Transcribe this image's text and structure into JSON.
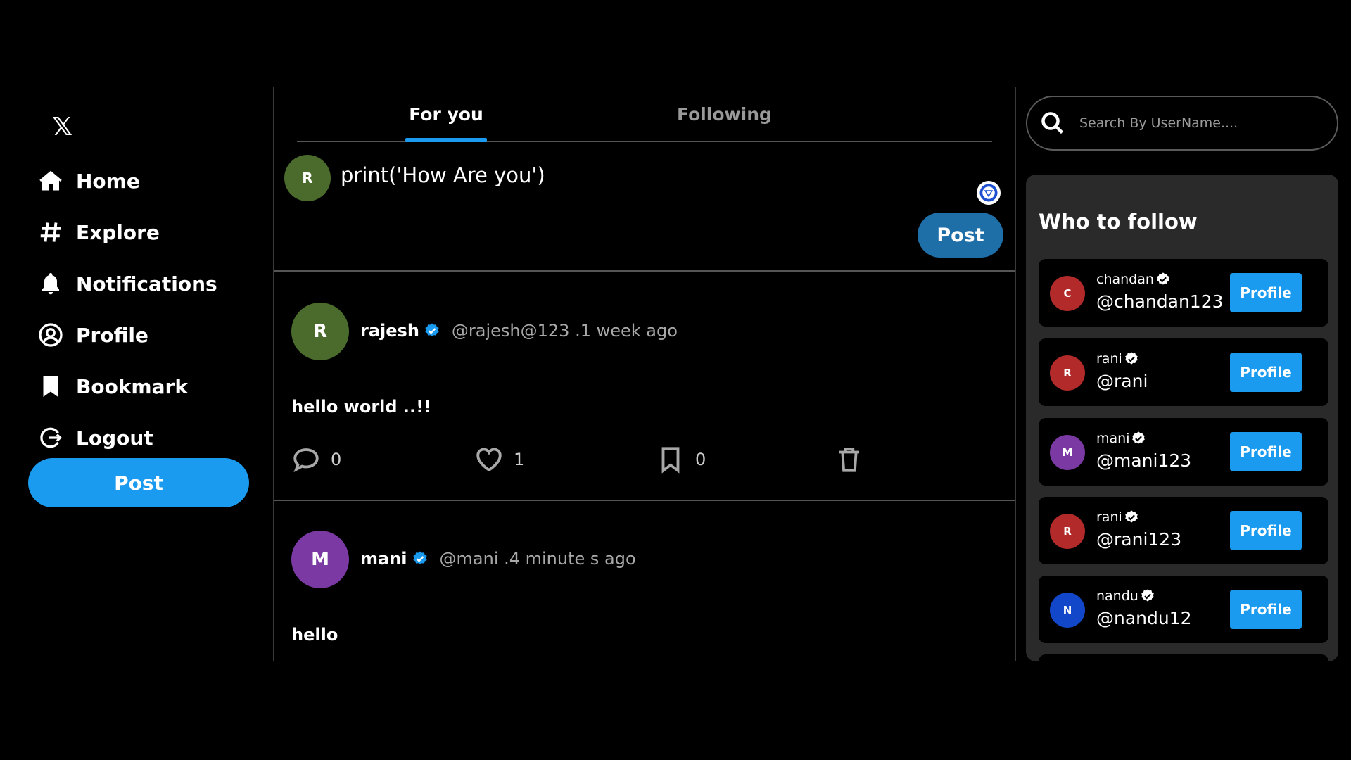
{
  "sidebar": {
    "logo": "𝕏",
    "items": [
      {
        "label": "Home",
        "icon": "home-icon"
      },
      {
        "label": "Explore",
        "icon": "hashtag-icon"
      },
      {
        "label": "Notifications",
        "icon": "bell-icon"
      },
      {
        "label": "Profile",
        "icon": "user-circle-icon"
      },
      {
        "label": "Bookmark",
        "icon": "bookmark-icon"
      },
      {
        "label": "Logout",
        "icon": "logout-icon"
      }
    ],
    "post_label": "Post"
  },
  "tabs": [
    {
      "label": "For you",
      "active": true
    },
    {
      "label": "Following",
      "active": false
    }
  ],
  "composer": {
    "avatar_letter": "R",
    "text": "print('How Are you')",
    "post_label": "Post"
  },
  "posts": [
    {
      "avatar_letter": "R",
      "avatar_color": "#4b6b2c",
      "name": "rajesh",
      "handle": "@rajesh@123 .1 week ago",
      "content": "hello world ..!!",
      "comments": "0",
      "likes": "1",
      "bookmarks": "0"
    },
    {
      "avatar_letter": "M",
      "avatar_color": "#7b3aa3",
      "name": "mani",
      "handle": "@mani .4 minute s ago",
      "content": "hello"
    }
  ],
  "search": {
    "placeholder": "Search By UserName...."
  },
  "who_to_follow": {
    "title": "Who to follow",
    "button_label": "Profile",
    "users": [
      {
        "letter": "C",
        "name": "chandan",
        "handle": "@chandan123",
        "color": "#b22a2a"
      },
      {
        "letter": "R",
        "name": "rani",
        "handle": "@rani",
        "color": "#b22a2a"
      },
      {
        "letter": "M",
        "name": "mani",
        "handle": "@mani123",
        "color": "#7b3aa3"
      },
      {
        "letter": "R",
        "name": "rani",
        "handle": "@rani123",
        "color": "#b22a2a"
      },
      {
        "letter": "N",
        "name": "nandu",
        "handle": "@nandu12",
        "color": "#1247c9"
      }
    ]
  },
  "colors": {
    "accent": "#1a9bef",
    "composer_post": "#1e6fa8",
    "background": "#000000",
    "panel": "#2a2a2a"
  }
}
